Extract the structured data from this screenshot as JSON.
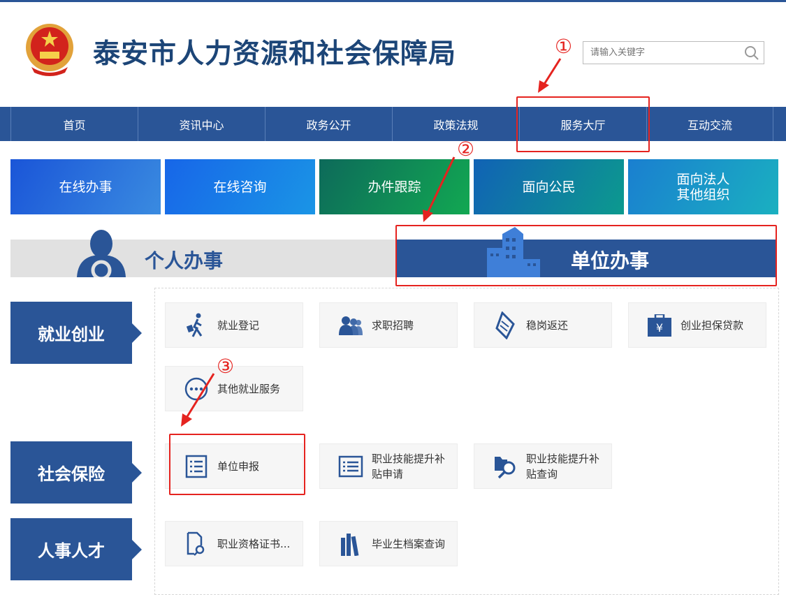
{
  "header": {
    "title": "泰安市人力资源和社会保障局",
    "search_placeholder": "请输入关键字"
  },
  "nav": [
    "首页",
    "资讯中心",
    "政务公开",
    "政策法规",
    "服务大厅",
    "互动交流"
  ],
  "tiles": [
    "在线办事",
    "在线咨询",
    "办件跟踪",
    "面向公民",
    "面向法人\n其他组织"
  ],
  "banner": {
    "personal": "个人办事",
    "unit": "单位办事"
  },
  "annotations": [
    "①",
    "②",
    "③"
  ],
  "categories": [
    "就业创业",
    "社会保险",
    "人事人才"
  ],
  "services": {
    "employment": [
      "就业登记",
      "求职招聘",
      "稳岗返还",
      "创业担保贷款",
      "其他就业服务"
    ],
    "insurance": [
      "单位申报",
      "职业技能提升补\n贴申请",
      "职业技能提升补\n贴查询"
    ],
    "personnel": [
      "职业资格证书...",
      "毕业生档案查询"
    ]
  },
  "colors": {
    "primary": "#2a5597",
    "annotation": "#e5231f"
  }
}
